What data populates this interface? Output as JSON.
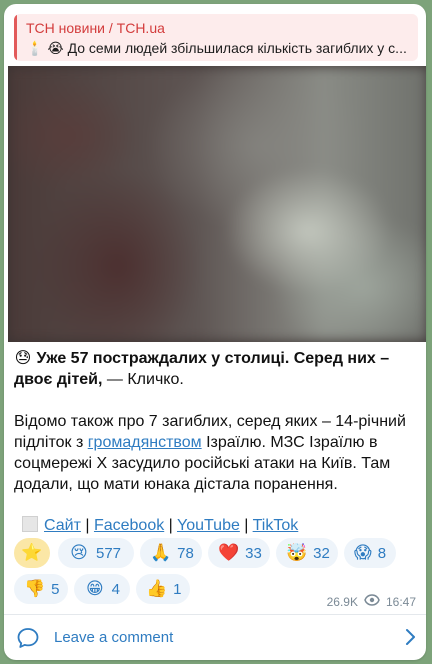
{
  "reply": {
    "author": "ТСН новини / TCH.ua",
    "text": "🕯️ 😭 До семи людей збільшилася кількість загиблих у с..."
  },
  "post": {
    "emoji_sad": "😓",
    "bold_text": "Уже 57 постраждалих у столиці. Серед них – двоє дітей,",
    "after_bold": " — Кличко.",
    "p2_before": "Відомо також про 7 загиблих, серед яких – 14-річний підліток з ",
    "p2_link": "громадянством",
    "p2_after": " Ізраїлю. МЗС Ізраїлю в соцмережі X засудило російські атаки на Київ. Там додали, що мати юнака дістала поранення.",
    "links": {
      "site": "Сайт",
      "sep1": " | ",
      "facebook": "Facebook",
      "sep2": " | ",
      "youtube": "YouTube",
      "sep3": " | ",
      "tiktok": "TikTok"
    }
  },
  "reactions": [
    {
      "emoji": "⭐",
      "count": ""
    },
    {
      "emoji": "😢",
      "count": "577"
    },
    {
      "emoji": "🙏",
      "count": "78"
    },
    {
      "emoji": "❤️",
      "count": "33"
    },
    {
      "emoji": "🤯",
      "count": "32"
    },
    {
      "emoji": "😱",
      "count": "8"
    },
    {
      "emoji": "👎",
      "count": "5"
    },
    {
      "emoji": "😁",
      "count": "4"
    },
    {
      "emoji": "👍",
      "count": "1"
    }
  ],
  "meta": {
    "views": "26.9K",
    "time": "16:47"
  },
  "comment": {
    "label": "Leave a comment"
  },
  "colors": {
    "accent": "#2f7cc1",
    "reply_accent": "#d33c3c",
    "chat_background": "#7da37a"
  }
}
